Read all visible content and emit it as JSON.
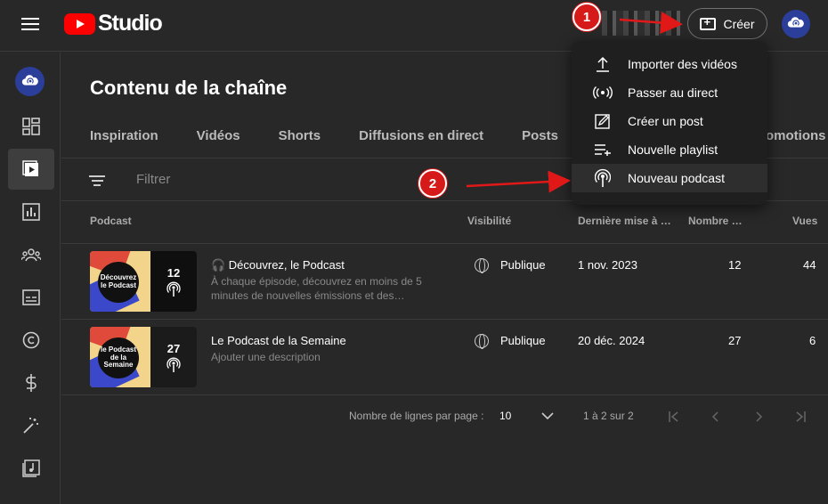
{
  "app": {
    "name": "Studio"
  },
  "header": {
    "create_label": "Créer"
  },
  "page": {
    "title": "Contenu de la chaîne"
  },
  "tabs": [
    "Inspiration",
    "Vidéos",
    "Shorts",
    "Diffusions en direct",
    "Posts"
  ],
  "tab_partial": "omotions",
  "filter": {
    "placeholder": "Filtrer"
  },
  "columns": {
    "podcast": "Podcast",
    "visibility": "Visibilité",
    "updated": "Dernière mise à …",
    "count": "Nombre …",
    "views": "Vues"
  },
  "rows": [
    {
      "title": "🎧 Découvrez, le Podcast",
      "description": "À chaque épisode, découvrez en moins de 5 minutes de nouvelles émissions et des…",
      "thumb_text": "Découvrez le Podcast",
      "episodes_badge": "12",
      "visibility": "Publique",
      "updated": "1 nov. 2023",
      "count": "12",
      "views": "44"
    },
    {
      "title": "Le Podcast de la Semaine",
      "description": "Ajouter une description",
      "thumb_text": "le Podcast de la Semaine",
      "episodes_badge": "27",
      "visibility": "Publique",
      "updated": "20 déc. 2024",
      "count": "27",
      "views": "6"
    }
  ],
  "pagination": {
    "rows_label": "Nombre de lignes par page :",
    "rows_value": "10",
    "range": "1 à 2 sur 2"
  },
  "create_menu": [
    {
      "label": "Importer des vidéos",
      "icon": "upload-icon"
    },
    {
      "label": "Passer au direct",
      "icon": "live-icon"
    },
    {
      "label": "Créer un post",
      "icon": "edit-icon"
    },
    {
      "label": "Nouvelle playlist",
      "icon": "playlist-add-icon"
    },
    {
      "label": "Nouveau podcast",
      "icon": "podcast-icon"
    }
  ],
  "annotations": {
    "step1": "1",
    "step2": "2"
  },
  "colors": {
    "accent_red": "#ff0000",
    "annotation_red": "#d61a1a",
    "background": "#282828",
    "menu_bg": "#1f1f1f"
  }
}
